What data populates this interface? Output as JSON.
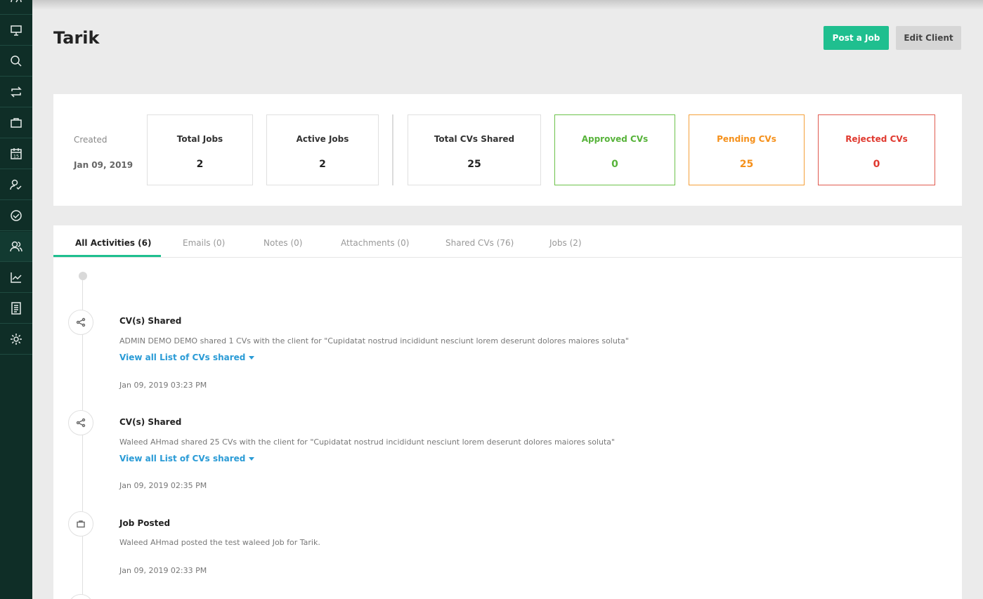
{
  "sidebar": {
    "items": [
      {
        "icon": "dashboard-icon"
      },
      {
        "icon": "monitor-icon"
      },
      {
        "icon": "search-icon"
      },
      {
        "icon": "repeat-icon"
      },
      {
        "icon": "briefcase-icon"
      },
      {
        "icon": "calendar-icon",
        "label": "15"
      },
      {
        "icon": "user-check-icon"
      },
      {
        "icon": "handshake-icon"
      },
      {
        "icon": "users-icon",
        "active": true
      },
      {
        "icon": "chart-line-icon"
      },
      {
        "icon": "document-icon"
      },
      {
        "icon": "gear-icon"
      }
    ]
  },
  "header": {
    "title": "Tarik",
    "post_job_label": "Post a Job",
    "edit_client_label": "Edit Client"
  },
  "stats": {
    "created_label": "Created",
    "created_date": "Jan 09, 2019",
    "total_jobs": {
      "label": "Total Jobs",
      "value": "2"
    },
    "active_jobs": {
      "label": "Active Jobs",
      "value": "2"
    },
    "total_cvs": {
      "label": "Total CVs Shared",
      "value": "25"
    },
    "approved_cvs": {
      "label": "Approved CVs",
      "value": "0"
    },
    "pending_cvs": {
      "label": "Pending CVs",
      "value": "25"
    },
    "rejected_cvs": {
      "label": "Rejected CVs",
      "value": "0"
    },
    "colors": {
      "approved": "#57b33a",
      "pending": "#f5901a",
      "rejected": "#e0392f",
      "accent": "#1fbf8f"
    }
  },
  "tabs": [
    {
      "label": "All Activities (6)",
      "active": true
    },
    {
      "label": "Emails (0)"
    },
    {
      "label": "Notes (0)"
    },
    {
      "label": "Attachments (0)"
    },
    {
      "label": "Shared CVs (76)"
    },
    {
      "label": "Jobs (2)"
    }
  ],
  "activities": [
    {
      "icon": "share-icon",
      "title": "CV(s) Shared",
      "description": "ADMIN DEMO DEMO shared 1 CVs with the client for \"Cupidatat nostrud incididunt nesciunt lorem deserunt dolores maiores soluta\"",
      "link": "View all List of CVs shared",
      "time": "Jan 09, 2019 03:23 PM"
    },
    {
      "icon": "share-icon",
      "title": "CV(s) Shared",
      "description": "Waleed AHmad shared 25 CVs with the client for \"Cupidatat nostrud incididunt nesciunt lorem deserunt dolores maiores soluta\"",
      "link": "View all List of CVs shared",
      "time": "Jan 09, 2019 02:35 PM"
    },
    {
      "icon": "briefcase-icon",
      "title": "Job Posted",
      "description": "Waleed AHmad posted the test waleed Job for Tarik.",
      "time": "Jan 09, 2019 02:33 PM"
    }
  ]
}
